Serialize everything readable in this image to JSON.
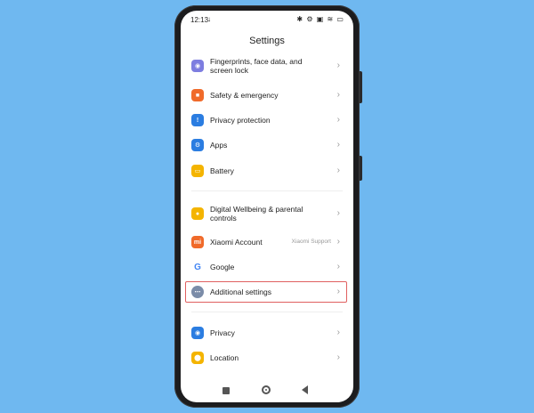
{
  "status_bar": {
    "time": "12:13",
    "download_indicator": "↓",
    "right_icons": "✱ ⚙ ▣ ≋ ▭"
  },
  "header": {
    "title": "Settings"
  },
  "settings_items": [
    {
      "label": "Fingerprints, face data, and screen lock",
      "icon": "fingerprint-icon",
      "color": "#7d7de0"
    },
    {
      "label": "Safety & emergency",
      "icon": "emergency-icon",
      "color": "#f06a2a"
    },
    {
      "label": "Privacy protection",
      "icon": "privacy-protection-icon",
      "color": "#2b7de1"
    },
    {
      "label": "Apps",
      "icon": "apps-icon",
      "color": "#2b7de1"
    },
    {
      "label": "Battery",
      "icon": "battery-icon",
      "color": "#f4b400"
    },
    {
      "label": "Digital Wellbeing & parental controls",
      "icon": "wellbeing-icon",
      "color": "#f4b400"
    },
    {
      "label": "Xiaomi Account",
      "icon": "xiaomi-icon",
      "color": "#f06a2a",
      "extra": "Xiaomi Support"
    },
    {
      "label": "Google",
      "icon": "google-icon",
      "color": "#ffffff"
    },
    {
      "label": "Additional settings",
      "icon": "additional-settings-icon",
      "color": "#7b8ca8"
    },
    {
      "label": "Privacy",
      "icon": "eye-icon",
      "color": "#2b7de1"
    },
    {
      "label": "Location",
      "icon": "location-icon",
      "color": "#f4b400"
    }
  ],
  "colors": {
    "background": "#6fb8f0",
    "highlight": "#e06060"
  }
}
